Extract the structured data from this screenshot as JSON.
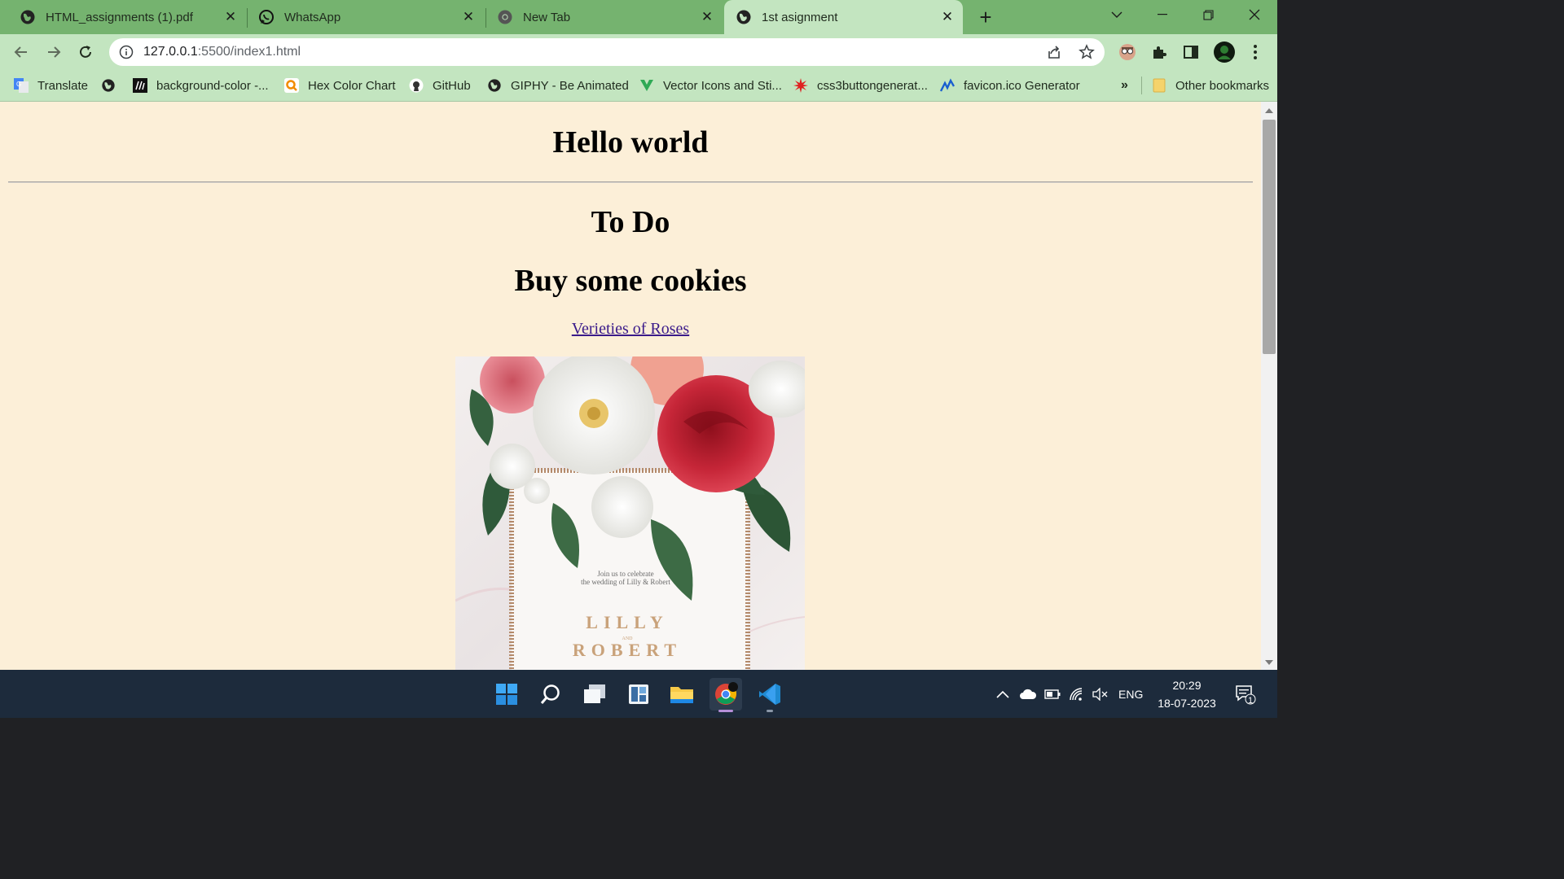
{
  "tabs": [
    {
      "label": "HTML_assignments (1).pdf",
      "icon": "globe-icon",
      "active": false
    },
    {
      "label": "WhatsApp",
      "icon": "whatsapp-icon",
      "active": false
    },
    {
      "label": "New Tab",
      "icon": "chrome-icon",
      "active": false
    },
    {
      "label": "1st asignment",
      "icon": "globe-icon",
      "active": true
    }
  ],
  "address": {
    "host": "127.0.0.1",
    "path": ":5500/index1.html"
  },
  "bookmarks": [
    {
      "label": "Translate",
      "icon": "google-translate-icon"
    },
    {
      "label": "",
      "icon": "globe-icon"
    },
    {
      "label": "background-color -...",
      "icon": "mdn-icon"
    },
    {
      "label": "Hex Color Chart",
      "icon": "hex-chart-icon"
    },
    {
      "label": "GitHub",
      "icon": "github-icon"
    },
    {
      "label": "GIPHY - Be Animated",
      "icon": "globe-icon"
    },
    {
      "label": "Vector Icons and Sti...",
      "icon": "vector-icon"
    },
    {
      "label": "css3buttongenerat...",
      "icon": "star-burst-icon"
    },
    {
      "label": "favicon.ico Generator",
      "icon": "favicon-generator-icon"
    }
  ],
  "bookmarks_overflow": "»",
  "other_bookmarks": "Other bookmarks",
  "page": {
    "heading": "Hello world",
    "todo_heading": "To Do",
    "item_heading": "Buy some cookies",
    "link_text": "Verieties of Roses",
    "card": {
      "line1": "Join us to celebrate",
      "line2": "the wedding of Lilly & Robert",
      "name1": "LILLY",
      "and": "AND",
      "name2": "ROBERT"
    }
  },
  "taskbar": {
    "apps": [
      "windows-start-icon",
      "search-icon",
      "task-view-icon",
      "widgets-icon",
      "file-explorer-icon",
      "chrome-icon",
      "vscode-icon"
    ],
    "language": "ENG",
    "time": "20:29",
    "date": "18-07-2023",
    "notification_count": "1"
  },
  "colors": {
    "tabstrip": "#75b36f",
    "toolbar": "#c3e5c0",
    "page_background": "#fcefd8",
    "taskbar": "#1d2b3c",
    "link": "#3a1a8a"
  }
}
